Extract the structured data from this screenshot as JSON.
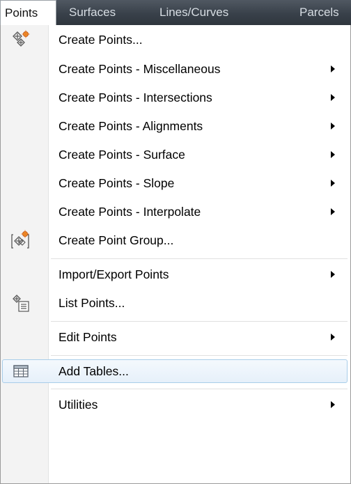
{
  "menubar": {
    "items": [
      "Points",
      "Surfaces",
      "Lines/Curves",
      "Parcels"
    ]
  },
  "menu": {
    "items": [
      {
        "label": "Create Points...",
        "icon": "create-points-icon",
        "submenu": false
      },
      {
        "label": "Create Points - Miscellaneous",
        "submenu": true
      },
      {
        "label": "Create Points - Intersections",
        "submenu": true
      },
      {
        "label": "Create Points - Alignments",
        "submenu": true
      },
      {
        "label": "Create Points - Surface",
        "submenu": true
      },
      {
        "label": "Create Points - Slope",
        "submenu": true
      },
      {
        "label": "Create Points - Interpolate",
        "submenu": true
      },
      {
        "label": "Create Point Group...",
        "icon": "create-point-group-icon",
        "submenu": false
      },
      {
        "label": "Import/Export Points",
        "submenu": true
      },
      {
        "label": "List Points...",
        "icon": "list-points-icon",
        "submenu": false
      },
      {
        "label": "Edit Points",
        "submenu": true
      },
      {
        "label": "Add Tables...",
        "icon": "table-icon",
        "submenu": false,
        "highlighted": true
      },
      {
        "label": "Utilities",
        "submenu": true
      }
    ]
  },
  "colors": {
    "menubar_bg": "#39414a",
    "menubar_text": "#d7dde3",
    "highlight_border": "#a8cde9",
    "icon_accent": "#e8731d"
  }
}
